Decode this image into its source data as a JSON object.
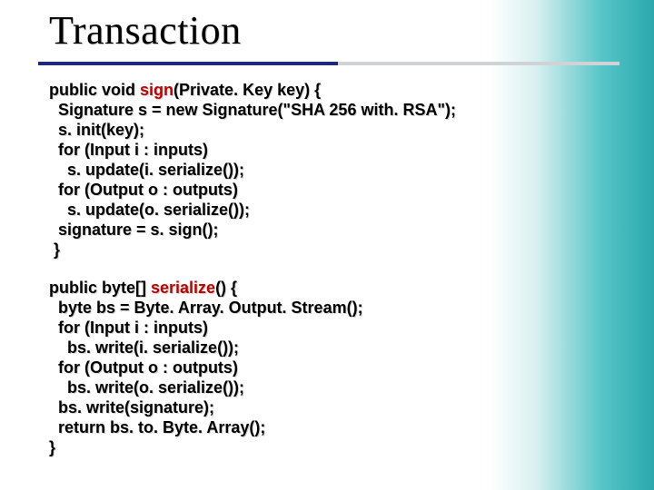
{
  "title": "Transaction",
  "code": {
    "sign": {
      "prefix1": "public void ",
      "name": "sign",
      "suffix1": "(Private. Key key) {",
      "l2": "  Signature s = new Signature(\"SHA 256 with. RSA\");",
      "l3": "  s. init(key);",
      "l4": "  for (Input i : inputs)",
      "l5": "    s. update(i. serialize());",
      "l6": "  for (Output o : outputs)",
      "l7": "    s. update(o. serialize());",
      "l8": "  signature = s. sign();",
      "l9": " }"
    },
    "serialize": {
      "prefix1": "public byte[] ",
      "name": "serialize",
      "suffix1": "() {",
      "l2": "  byte bs = Byte. Array. Output. Stream();",
      "l3": "  for (Input i : inputs)",
      "l4": "    bs. write(i. serialize());",
      "l5": "  for (Output o : outputs)",
      "l6": "    bs. write(o. serialize());",
      "l7": "  bs. write(signature);",
      "l8": "  return bs. to. Byte. Array();",
      "l9": "}"
    }
  }
}
